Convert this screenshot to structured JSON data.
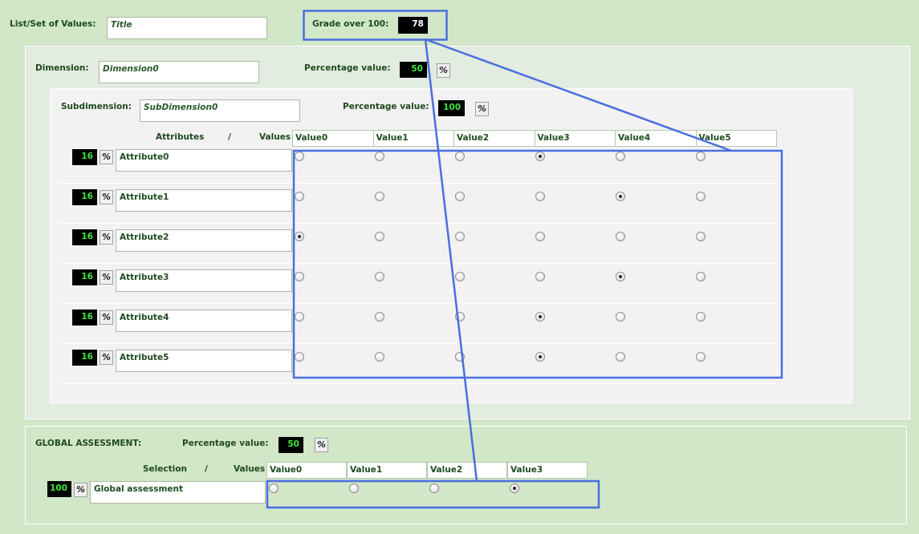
{
  "top": {
    "list_label": "List/Set of Values:",
    "list_value": "Title",
    "grade_label": "Grade over 100:",
    "grade_value": "78"
  },
  "dimension": {
    "label": "Dimension:",
    "value": "Dimension0",
    "percentage_label": "Percentage value:",
    "percentage_value": "50"
  },
  "subdimension": {
    "label": "Subdimension:",
    "value": "SubDimension0",
    "percentage_label": "Percentage value:",
    "percentage_value": "100",
    "attributes_label": "Attributes",
    "slash": "/",
    "values_label": "Values",
    "columns": [
      "Value0",
      "Value1",
      "Value2",
      "Value3",
      "Value4",
      "Value5"
    ],
    "rows": [
      {
        "weight": "16",
        "name": "Attribute0",
        "selected": 3
      },
      {
        "weight": "16",
        "name": "Attribute1",
        "selected": 4
      },
      {
        "weight": "16",
        "name": "Attribute2",
        "selected": 0
      },
      {
        "weight": "16",
        "name": "Attribute3",
        "selected": 4
      },
      {
        "weight": "16",
        "name": "Attribute4",
        "selected": 3
      },
      {
        "weight": "16",
        "name": "Attribute5",
        "selected": 3
      }
    ]
  },
  "global": {
    "label": "GLOBAL ASSESSMENT:",
    "percentage_label": "Percentage value:",
    "percentage_value": "50",
    "selection_label": "Selection",
    "slash": "/",
    "values_label": "Values",
    "columns": [
      "Value0",
      "Value1",
      "Value2",
      "Value3"
    ],
    "weight": "100",
    "name": "Global assessment",
    "selected": 3
  },
  "icons": {
    "percent": "percent-icon"
  },
  "colors": {
    "highlight": "#4a6ee0",
    "panel_bg": "#e2ece0",
    "inner_bg": "#f2f2f2"
  }
}
